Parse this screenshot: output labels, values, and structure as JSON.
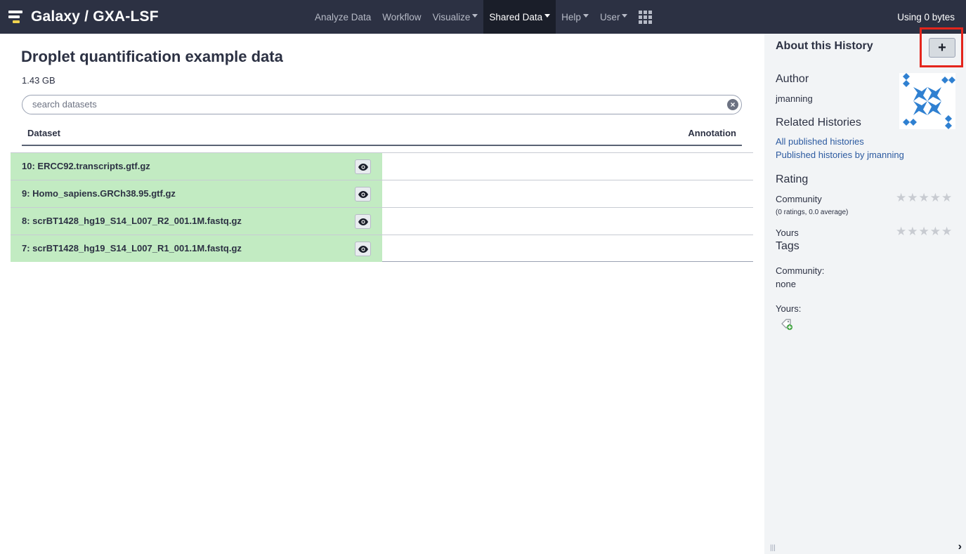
{
  "masthead": {
    "brand": "Galaxy / GXA-LSF",
    "nav": [
      {
        "label": "Analyze Data",
        "dropdown": false,
        "active": false
      },
      {
        "label": "Workflow",
        "dropdown": false,
        "active": false
      },
      {
        "label": "Visualize",
        "dropdown": true,
        "active": false
      },
      {
        "label": "Shared Data",
        "dropdown": true,
        "active": true
      },
      {
        "label": "Help",
        "dropdown": true,
        "active": false
      },
      {
        "label": "User",
        "dropdown": true,
        "active": false
      }
    ],
    "apps_icon": "grid-icon",
    "quota": "Using 0 bytes"
  },
  "history": {
    "title": "Droplet quantification example data",
    "size": "1.43 GB",
    "search_placeholder": "search datasets",
    "columns": {
      "dataset": "Dataset",
      "annotation": "Annotation"
    },
    "datasets": [
      {
        "name": "10: ERCC92.transcripts.gtf.gz"
      },
      {
        "name": "9: Homo_sapiens.GRCh38.95.gtf.gz"
      },
      {
        "name": "8: scrBT1428_hg19_S14_L007_R2_001.1M.fastq.gz"
      },
      {
        "name": "7: scrBT1428_hg19_S14_L007_R1_001.1M.fastq.gz"
      }
    ]
  },
  "about": {
    "title": "About this History",
    "import_label": "+",
    "author_heading": "Author",
    "author": "jmanning",
    "related_heading": "Related Histories",
    "related_links": [
      "All published histories",
      "Published histories by jmanning"
    ],
    "rating_heading": "Rating",
    "community_label": "Community",
    "community_summary": "(0 ratings, 0.0 average)",
    "yours_label": "Yours",
    "tags_heading": "Tags",
    "community_tags_label": "Community:",
    "community_tags_value": "none",
    "your_tags_label": "Yours:",
    "colors": {
      "link": "#2c5aa0",
      "dataset_ok": "#c2ebc2",
      "highlight": "#e4251c",
      "masthead": "#2c3143"
    }
  }
}
